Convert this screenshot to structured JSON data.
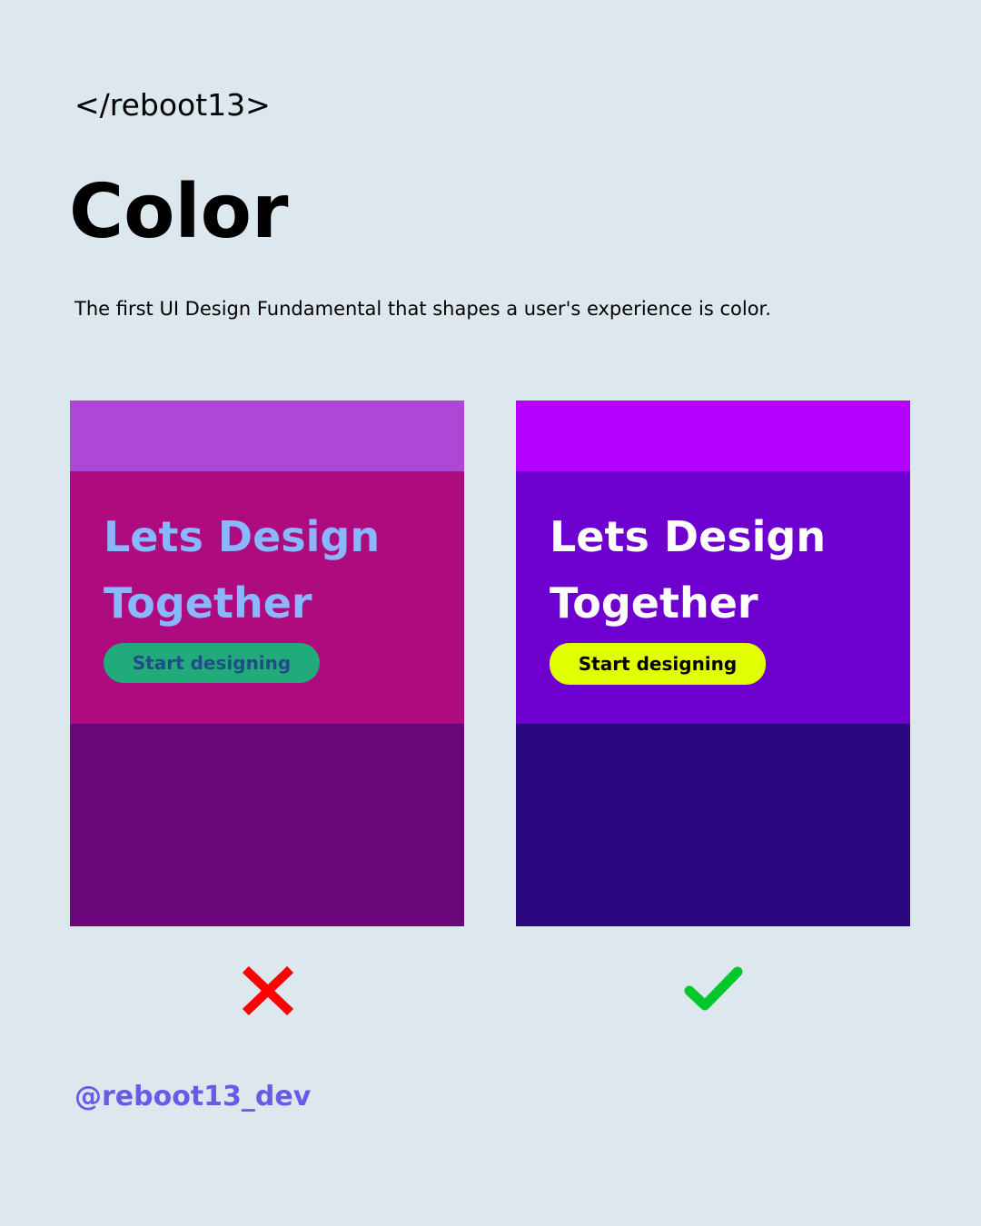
{
  "brand": "</reboot13>",
  "title": "Color",
  "subtitle": "The first UI Design Fundamental that shapes a user's experience is color.",
  "examples": {
    "bad": {
      "headline_line1": "Lets Design",
      "headline_line2": "Together",
      "button_label": "Start designing",
      "verdict_icon": "cross-icon",
      "colors": {
        "top_band": "#ae47d6",
        "hero_bg": "#ae0b7e",
        "bottom_band": "#6c077b",
        "headline": "#8ab6fb",
        "button_bg": "#22ab7a",
        "button_text": "#234a8b",
        "verdict": "#ff0000"
      }
    },
    "good": {
      "headline_line1": "Lets Design",
      "headline_line2": "Together",
      "button_label": "Start designing",
      "verdict_icon": "check-icon",
      "colors": {
        "top_band": "#b300ff",
        "hero_bg": "#6e00cf",
        "bottom_band": "#2b0880",
        "headline": "#ffffff",
        "button_bg": "#e2ff00",
        "button_text": "#000000",
        "verdict": "#00c82a"
      }
    }
  },
  "handle": "@reboot13_dev",
  "colors": {
    "page_bg": "#dde7ee",
    "handle": "#6a5be6"
  }
}
